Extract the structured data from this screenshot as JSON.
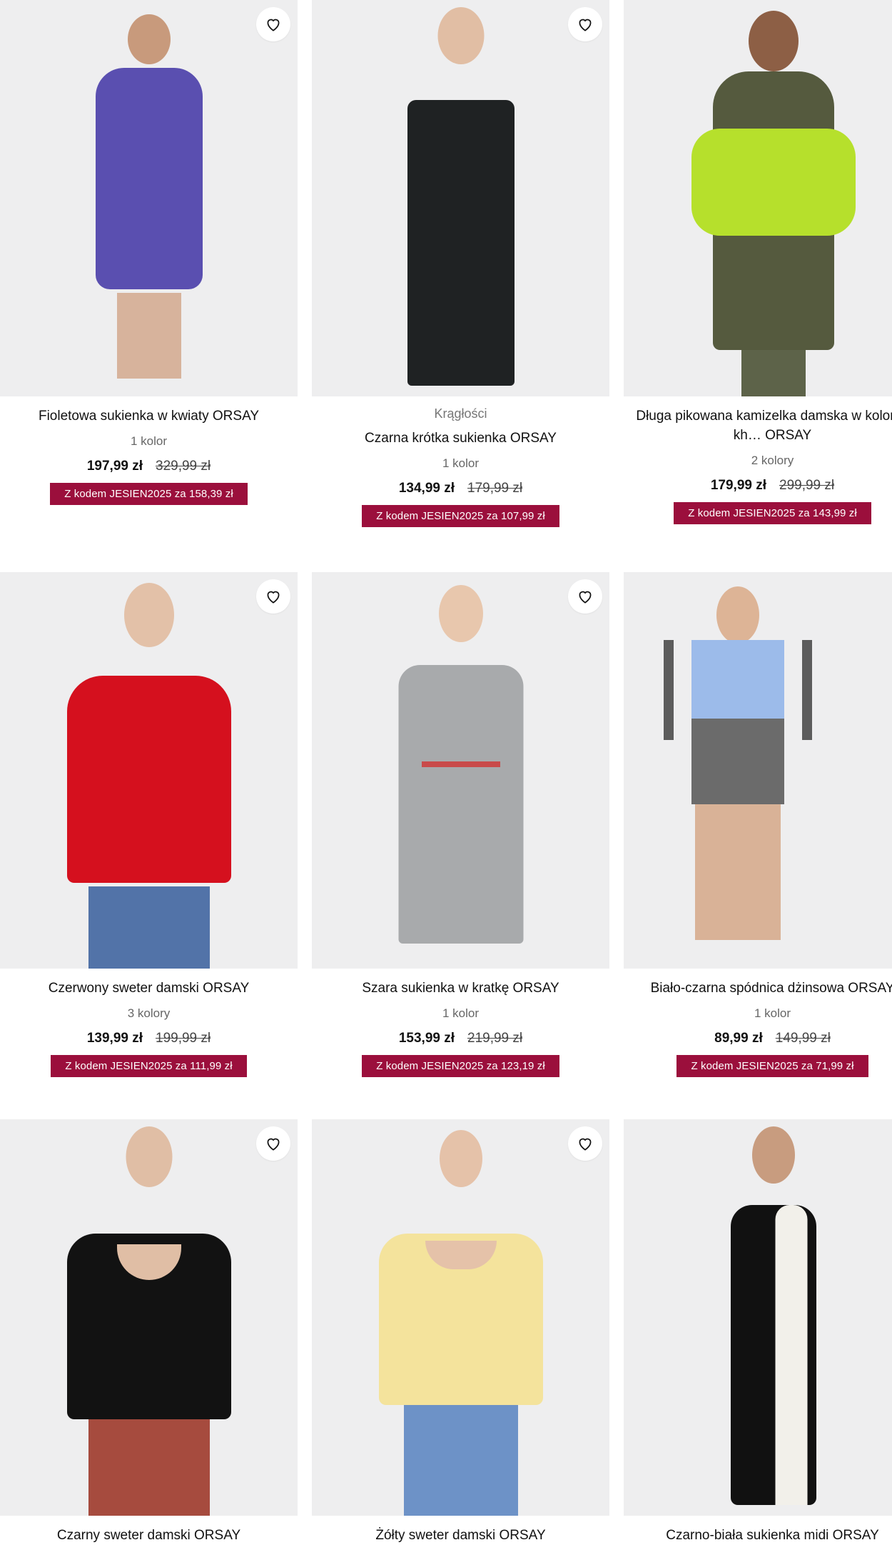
{
  "products": [
    {
      "name": "Fioletowa sukienka w kwiaty ORSAY",
      "colors": "1 kolor",
      "price": "197,99 zł",
      "old_price": "329,99 zł",
      "promo": "Z kodem JESIEN2025 za 158,39 zł"
    },
    {
      "badge": "Krągłości",
      "name": "Czarna krótka sukienka ORSAY",
      "colors": "1 kolor",
      "price": "134,99 zł",
      "old_price": "179,99 zł",
      "promo": "Z kodem JESIEN2025 za 107,99 zł"
    },
    {
      "name": "Długa pikowana kamizelka damska w kolorze kh… ORSAY",
      "colors": "2 kolory",
      "price": "179,99 zł",
      "old_price": "299,99 zł",
      "promo": "Z kodem JESIEN2025 za 143,99 zł"
    },
    {
      "name": "Czerwony sweter damski ORSAY",
      "colors": "3 kolory",
      "price": "139,99 zł",
      "old_price": "199,99 zł",
      "promo": "Z kodem JESIEN2025 za 111,99 zł"
    },
    {
      "name": "Szara sukienka w kratkę ORSAY",
      "colors": "1 kolor",
      "price": "153,99 zł",
      "old_price": "219,99 zł",
      "promo": "Z kodem JESIEN2025 za 123,19 zł"
    },
    {
      "name": "Biało-czarna spódnica dżinsowa ORSAY",
      "colors": "1 kolor",
      "price": "89,99 zł",
      "old_price": "149,99 zł",
      "promo": "Z kodem JESIEN2025 za 71,99 zł"
    },
    {
      "name": "Czarny sweter damski ORSAY"
    },
    {
      "name": "Żółty sweter damski ORSAY"
    },
    {
      "name": "Czarno-biała sukienka midi ORSAY"
    }
  ],
  "icons": {
    "favorite": "heart-outline-icon"
  },
  "colors": {
    "promo_bg": "#9b0f3c",
    "image_bg": "#eeeeef"
  }
}
